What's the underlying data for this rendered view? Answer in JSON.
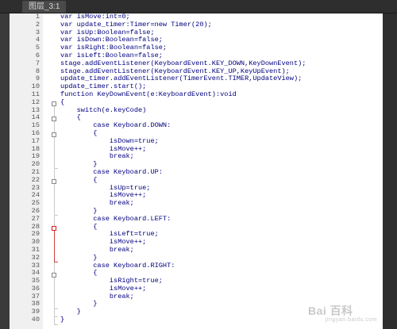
{
  "tab": {
    "title": "图层_3:1"
  },
  "watermark": {
    "text": "Bai 百科",
    "sub": "jingyan.baidu.com"
  },
  "line_numbers": [
    "1",
    "2",
    "3",
    "4",
    "5",
    "6",
    "7",
    "8",
    "9",
    "10",
    "11",
    "12",
    "13",
    "14",
    "15",
    "16",
    "17",
    "18",
    "19",
    "20",
    "21",
    "22",
    "23",
    "24",
    "25",
    "26",
    "27",
    "28",
    "29",
    "30",
    "31",
    "32",
    "33",
    "34",
    "35",
    "36",
    "37",
    "38",
    "39",
    "40"
  ],
  "code": [
    "var isMove:int=0;",
    "var update_timer:Timer=new Timer(20);",
    "var isUp:Boolean=false;",
    "var isDown:Boolean=false;",
    "var isRight:Boolean=false;",
    "var isLeft:Boolean=false;",
    "stage.addEventListener(KeyboardEvent.KEY_DOWN,KeyDownEvent);",
    "stage.addEventListener(KeyboardEvent.KEY_UP,KeyUpEvent);",
    "update_timer.addEventListener(TimerEvent.TIMER,UpdateView);",
    "update_timer.start();",
    "function KeyDownEvent(e:KeyboardEvent):void",
    "{",
    "    switch(e.keyCode)",
    "    {",
    "        case Keyboard.DOWN:",
    "        {",
    "            isDown=true;",
    "            isMove++;",
    "            break;",
    "        }",
    "        case Keyboard.UP:",
    "        {",
    "            isUp=true;",
    "            isMove++;",
    "            break;",
    "        }",
    "        case Keyboard.LEFT:",
    "        {",
    "            isLeft=true;",
    "            isMove++;",
    "            break;",
    "        }",
    "        case Keyboard.RIGHT:",
    "        {",
    "            isRight=true;",
    "            isMove++;",
    "            break;",
    "        }",
    "    }",
    "}"
  ]
}
